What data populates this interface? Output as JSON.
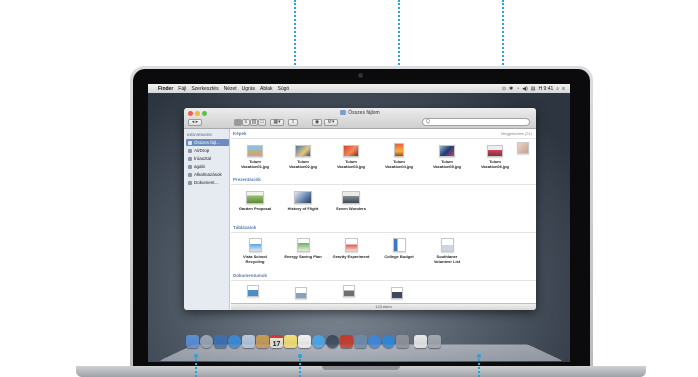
{
  "menubar": {
    "apple_glyph": "",
    "items": [
      "Finder",
      "Fájl",
      "Szerkesztés",
      "Nézet",
      "Ugrás",
      "Ablak",
      "Súgó"
    ],
    "clock": "H 9:41",
    "status_glyphs": [
      "⊙",
      "✱",
      "◔",
      "◀)",
      "▤",
      "⌕",
      "≡"
    ]
  },
  "finder": {
    "title": "Összes fájlom",
    "search_placeholder": "Q",
    "sidebar": {
      "header": "KEDVENCEK",
      "items": [
        {
          "label": "Összes fájl…",
          "selected": true
        },
        {
          "label": "AirDrop",
          "selected": false
        },
        {
          "label": "Íróasztal",
          "selected": false
        },
        {
          "label": "agabi",
          "selected": false
        },
        {
          "label": "Alkalmazások",
          "selected": false
        },
        {
          "label": "Dokument…",
          "selected": false
        }
      ]
    },
    "groups": [
      {
        "label": "Képek",
        "right": "Megjelenítés (21)"
      },
      {
        "label": "Prezentációk",
        "right": ""
      },
      {
        "label": "Táblázatok",
        "right": ""
      },
      {
        "label": "Dokumentumok",
        "right": ""
      }
    ],
    "images": [
      "Tulum Vacation01.jpg",
      "Tulum Vacation02.jpg",
      "Tulum Vacation03.jpg",
      "Tulum Vacation04.jpg",
      "Tulum Vacation05.jpg",
      "Tulum Vacation06.jpg"
    ],
    "presentations": [
      "Garden Proposal",
      "History of Flight",
      "Seven Wonders"
    ],
    "spreadsheets": [
      "Vista School Recycling",
      "Energy Saving Plan",
      "Gravity Experiment",
      "College Budget",
      "Southlaner Volunteer List"
    ],
    "status_text": "123 elem"
  },
  "dock": {
    "icons": [
      "finder-icon",
      "launchpad-icon",
      "mission-control-icon",
      "safari-icon",
      "mail-icon",
      "contacts-icon",
      "calendar-icon",
      "notes-icon",
      "reminders-icon",
      "messages-icon",
      "facetime-icon",
      "photo-booth-icon",
      "iphoto-icon",
      "itunes-icon",
      "app-store-icon",
      "system-preferences-icon",
      "documents-stack-icon",
      "trash-icon"
    ],
    "calendar_day": "17",
    "colors": [
      "#5b8fd6",
      "#9aa5b5",
      "#3c6fb0",
      "#3a8ad8",
      "#b8c7dc",
      "#c79b54",
      "#e7e4da",
      "#f3e173",
      "#f2f2f2",
      "#4aa5e8",
      "#3c4b5a",
      "#c23a2a",
      "#6c8aa6",
      "#3f86d8",
      "#2f85d6",
      "#8c9099",
      "#e9e9ea",
      "#a2a7ae"
    ]
  },
  "colors": {
    "callout": "#2aa3d9",
    "selection": "#6d8bbf",
    "group_label": "#5a7ba8"
  }
}
